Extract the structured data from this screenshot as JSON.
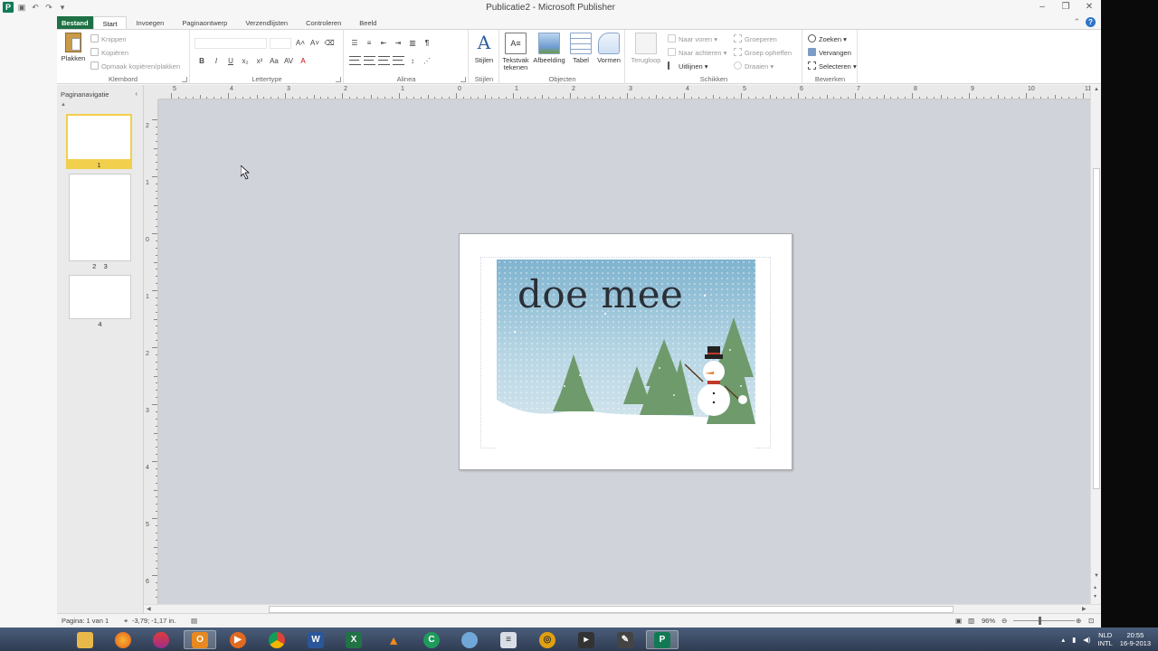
{
  "window": {
    "title": "Publicatie2 - Microsoft Publisher",
    "app_letter": "P",
    "minimize": "–",
    "maximize": "❐",
    "close": "✕"
  },
  "tabs": {
    "file": "Bestand",
    "items": [
      "Start",
      "Invoegen",
      "Paginaontwerp",
      "Verzendlijsten",
      "Controleren",
      "Beeld"
    ],
    "active": "Start"
  },
  "ribbon": {
    "klembord": {
      "label": "Klembord",
      "paste": "Plakken",
      "cut": "Knippen",
      "copy": "Kopiëren",
      "format_painter": "Opmaak kopiëren/plakken"
    },
    "lettertype": {
      "label": "Lettertype"
    },
    "alinea": {
      "label": "Alinea"
    },
    "stijlen": {
      "label": "Stijlen",
      "button": "Stijlen"
    },
    "objecten": {
      "label": "Objecten",
      "textbox": "Tekstvak tekenen",
      "picture": "Afbeelding",
      "table": "Tabel",
      "shapes": "Vormen"
    },
    "schikken": {
      "label": "Schikken",
      "wrap": "Terugloop",
      "bring_forward": "Naar voren",
      "send_backward": "Naar achteren",
      "align": "Uitlijnen",
      "group": "Groeperen",
      "ungroup": "Groep opheffen",
      "rotate": "Draaien"
    },
    "bewerken": {
      "label": "Bewerken",
      "find": "Zoeken",
      "replace": "Vervangen",
      "select": "Selecteren"
    }
  },
  "navpane": {
    "title": "Paginanavigatie",
    "collapse": "‹",
    "pages": [
      {
        "label": "1",
        "selected": true
      },
      {
        "label": "2    3",
        "selected": false
      },
      {
        "label": "4",
        "selected": false
      }
    ]
  },
  "rulers": {
    "horizontal": [
      "5",
      "4",
      "3",
      "2",
      "1",
      "0",
      "1",
      "2",
      "3",
      "4",
      "5",
      "6",
      "7",
      "8",
      "9",
      "10",
      "11"
    ],
    "vertical": [
      "2",
      "1",
      "0",
      "1",
      "2",
      "3",
      "4",
      "5",
      "6"
    ]
  },
  "card": {
    "title": "doe mee"
  },
  "statusbar": {
    "page": "Pagina: 1 van 1",
    "position": "-3,79; -1,17 in.",
    "zoom": "96%"
  },
  "taskbar": {
    "apps": [
      "Verkenner",
      "Firefox",
      "Firefox Nightly",
      "Outlook",
      "Mediaspeler",
      "Chrome",
      "Word",
      "Excel",
      "Groen",
      "Paint",
      "VLC",
      "Notities",
      "Programma",
      "Compass",
      "Terminal",
      "Gereedschap",
      "Publisher"
    ],
    "language": "NLD",
    "layout": "INTL",
    "time": "20:55",
    "date": "16-9-2013"
  },
  "colors": {
    "file_tab": "#1e7145",
    "publisher_green": "#117a54",
    "workspace": "#d0d3d9",
    "selected_thumb": "#f2cf4c"
  }
}
